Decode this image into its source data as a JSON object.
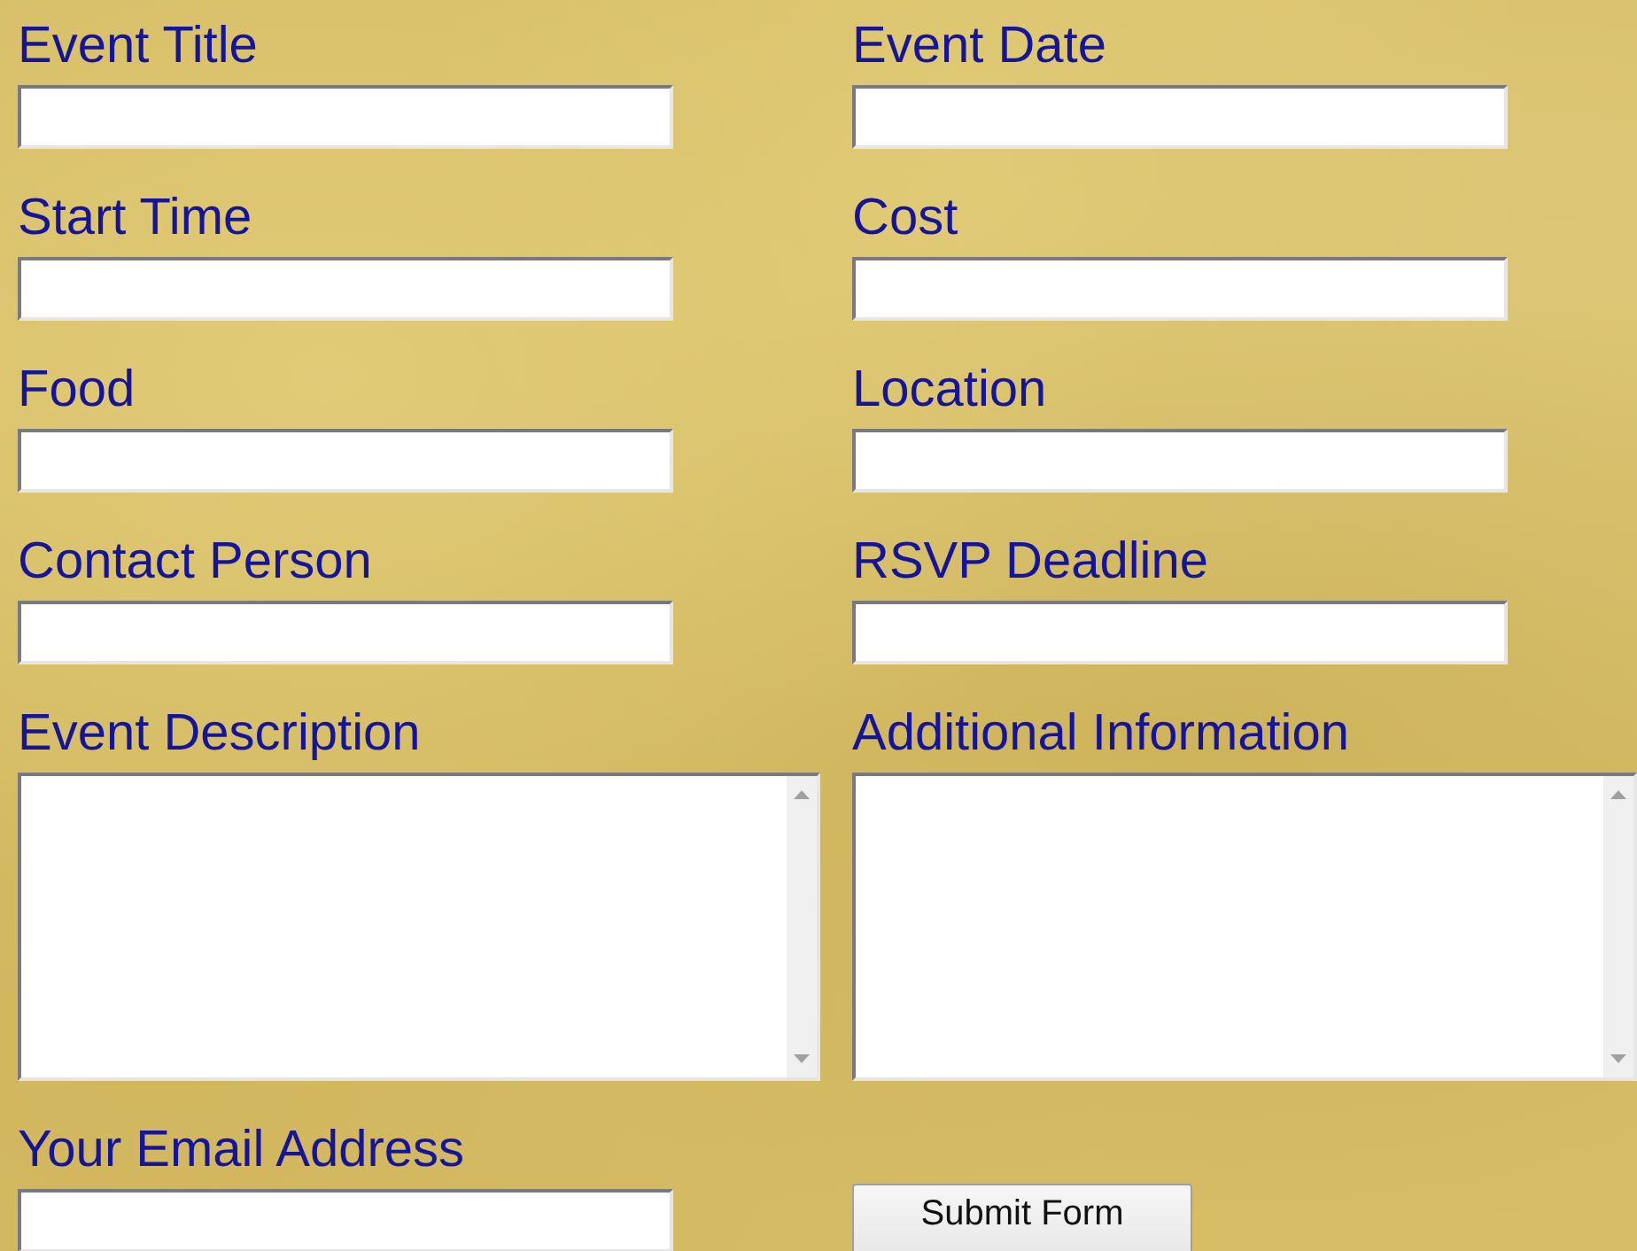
{
  "fields": [
    {
      "label": "Event Title",
      "kind": "text"
    },
    {
      "label": "Event Date",
      "kind": "text"
    },
    {
      "label": "Start Time",
      "kind": "text"
    },
    {
      "label": "Cost",
      "kind": "text"
    },
    {
      "label": "Food",
      "kind": "text"
    },
    {
      "label": "Location",
      "kind": "text"
    },
    {
      "label": "Contact Person",
      "kind": "text"
    },
    {
      "label": "RSVP Deadline",
      "kind": "text"
    },
    {
      "label": "Event Description",
      "kind": "textarea"
    },
    {
      "label": "Additional Information",
      "kind": "textarea"
    },
    {
      "label": "Your Email Address",
      "kind": "text"
    }
  ],
  "submit_button": "Submit Form"
}
